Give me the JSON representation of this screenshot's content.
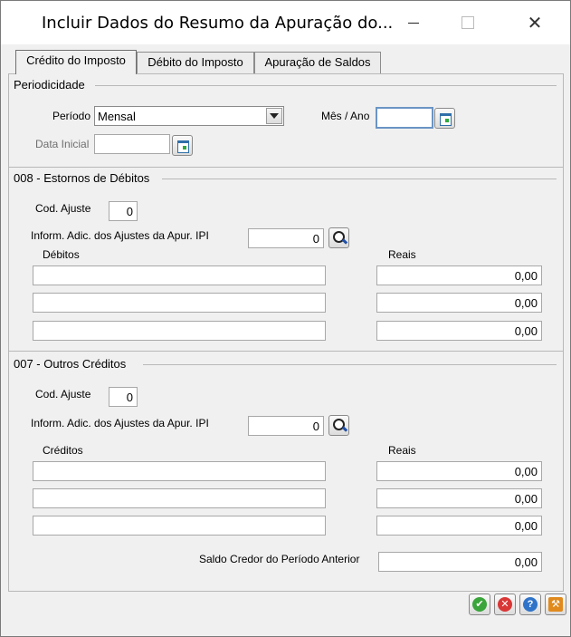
{
  "window": {
    "title": "Incluir Dados do Resumo da Apuração do..."
  },
  "tabs": [
    {
      "label": "Crédito do Imposto",
      "active": true
    },
    {
      "label": "Débito do Imposto",
      "active": false
    },
    {
      "label": "Apuração de Saldos",
      "active": false
    }
  ],
  "periodicidade": {
    "title": "Periodicidade",
    "periodo_label": "Período",
    "periodo_value": "Mensal",
    "mes_ano_label": "Mês / Ano",
    "mes_ano_value": "",
    "data_inicial_label": "Data Inicial",
    "data_inicial_value": ""
  },
  "estornos": {
    "title": "008 - Estornos de Débitos",
    "cod_ajuste_label": "Cod. Ajuste",
    "cod_ajuste_value": "0",
    "inform_label": "Inform. Adic. dos Ajustes da Apur. IPI",
    "inform_value": "0",
    "col_left": "Débitos",
    "col_right": "Reais",
    "rows": [
      {
        "desc": "",
        "value": "0,00"
      },
      {
        "desc": "",
        "value": "0,00"
      },
      {
        "desc": "",
        "value": "0,00"
      }
    ]
  },
  "outros": {
    "title": "007 - Outros Créditos",
    "cod_ajuste_label": "Cod. Ajuste",
    "cod_ajuste_value": "0",
    "inform_label": "Inform. Adic. dos Ajustes da Apur. IPI",
    "inform_value": "0",
    "col_left": "Créditos",
    "col_right": "Reais",
    "rows": [
      {
        "desc": "",
        "value": "0,00"
      },
      {
        "desc": "",
        "value": "0,00"
      },
      {
        "desc": "",
        "value": "0,00"
      }
    ],
    "saldo_label": "Saldo Credor do Período Anterior",
    "saldo_value": "0,00"
  },
  "colors": {
    "ok": "#3aa53a",
    "cancel": "#d93636",
    "help": "#2f74c9",
    "tools": "#e08a1e"
  }
}
